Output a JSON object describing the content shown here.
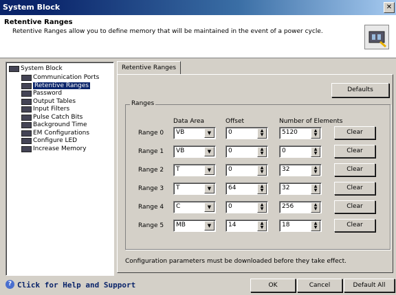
{
  "window": {
    "title": "System Block"
  },
  "header": {
    "title": "Retentive Ranges",
    "description": "Retentive Ranges allow you to define memory that will be maintained in the event of a power cycle.",
    "icon": "system-block-icon"
  },
  "tree": {
    "root": "System Block",
    "items": [
      "Communication Ports",
      "Retentive Ranges",
      "Password",
      "Output Tables",
      "Input Filters",
      "Pulse Catch Bits",
      "Background Time",
      "EM Configurations",
      "Configure LED",
      "Increase Memory"
    ],
    "selected": "Retentive Ranges"
  },
  "tab": {
    "label": "Retentive Ranges"
  },
  "defaults_label": "Defaults",
  "ranges": {
    "group_label": "Ranges",
    "col_data_area": "Data Area",
    "col_offset": "Offset",
    "col_count": "Number of Elements",
    "rows": [
      {
        "label": "Range 0",
        "area": "VB",
        "offset": "0",
        "count": "5120",
        "clear": "Clear"
      },
      {
        "label": "Range 1",
        "area": "VB",
        "offset": "0",
        "count": "0",
        "clear": "Clear"
      },
      {
        "label": "Range 2",
        "area": "T",
        "offset": "0",
        "count": "32",
        "clear": "Clear"
      },
      {
        "label": "Range 3",
        "area": "T",
        "offset": "64",
        "count": "32",
        "clear": "Clear"
      },
      {
        "label": "Range 4",
        "area": "C",
        "offset": "0",
        "count": "256",
        "clear": "Clear"
      },
      {
        "label": "Range 5",
        "area": "MB",
        "offset": "14",
        "count": "18",
        "clear": "Clear"
      }
    ]
  },
  "note": "Configuration parameters must be downloaded before they take effect.",
  "footer": {
    "help": "Click for Help and Support",
    "ok": "OK",
    "cancel": "Cancel",
    "default_all": "Default All"
  }
}
